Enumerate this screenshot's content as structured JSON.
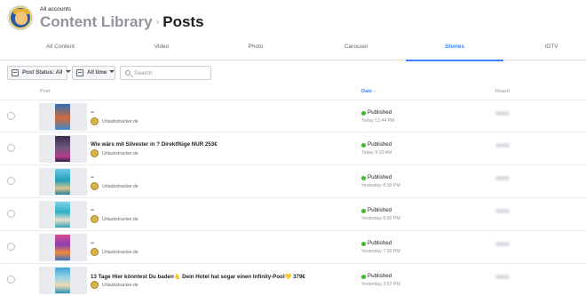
{
  "header": {
    "all_accounts": "All accounts",
    "breadcrumb_library": "Content Library",
    "breadcrumb_separator": "›",
    "breadcrumb_current": "Posts"
  },
  "tabs": [
    "All Content",
    "Video",
    "Photo",
    "Carousel",
    "Stories",
    "IGTV"
  ],
  "active_tab": "Stories",
  "filters": {
    "post_status_label": "Post Status:",
    "post_status_value": "All",
    "time_label": "All time",
    "search_placeholder": "Search",
    "search_value": ""
  },
  "columns": {
    "post": "Post",
    "date": "Date ↓",
    "reach": "Reach"
  },
  "colors": {
    "accent": "#4080ff",
    "published": "#42b72a"
  },
  "rows": [
    {
      "title": "--",
      "account": "Urlaubstracker.de",
      "status": "Published",
      "time": "Today 12:44 PM"
    },
    {
      "title": "Wie wärs mit Silvester in ? Direktflüge NUR 253€",
      "account": "Urlaubstracker.de",
      "status": "Published",
      "time": "Today 9:10 AM"
    },
    {
      "title": "--",
      "account": "Urlaubstracker.de",
      "status": "Published",
      "time": "Yesterday 8:38 PM"
    },
    {
      "title": "--",
      "account": "Urlaubstracker.de",
      "status": "Published",
      "time": "Yesterday 8:00 PM"
    },
    {
      "title": "--",
      "account": "Urlaubstracker.de",
      "status": "Published",
      "time": "Yesterday 7:30 PM"
    },
    {
      "title": "13 Tage Hier könntest Du baden👆 Dein Hotel hat sogar einen Infinity-Pool💛 379€",
      "account": "Urlaubstracker.de",
      "status": "Published",
      "time": "Yesterday 3:52 PM"
    }
  ]
}
